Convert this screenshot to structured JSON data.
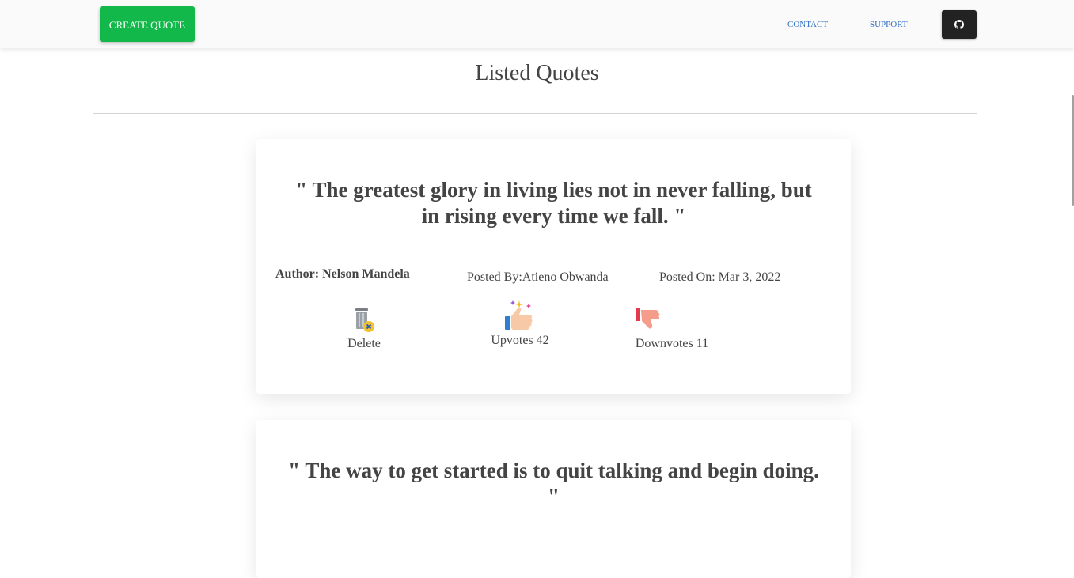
{
  "navbar": {
    "create_label": "CREATE QUOTE",
    "contact_label": "CONTACT",
    "support_label": "SUPPORT",
    "github_icon": "github-icon"
  },
  "page": {
    "title": "Listed Quotes"
  },
  "quotes": [
    {
      "text": "\" The greatest glory in living lies not in never falling, but in rising every time we fall. \"",
      "author_label": "Author:",
      "author": "Nelson Mandela",
      "posted_by": "Posted By:Atieno Obwanda",
      "posted_on": "Posted On: Mar 3, 2022",
      "delete_label": "Delete",
      "upvotes_label": "Upvotes 42",
      "downvotes_label": "Downvotes 11"
    },
    {
      "text": "\" The way to get started is to quit talking and begin doing. \""
    }
  ],
  "colors": {
    "create_button": "#12b94a",
    "link": "#2f6fc6",
    "github_button": "#222222"
  }
}
